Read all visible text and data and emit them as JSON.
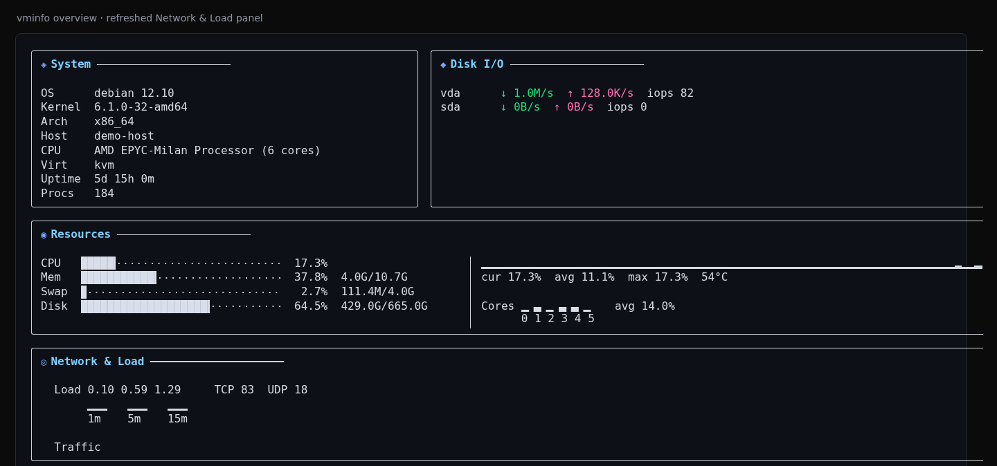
{
  "header": "vminfo overview · refreshed Network & Load panel",
  "system": {
    "icon": "◈",
    "title": "System",
    "rows": [
      {
        "label": "OS",
        "value": "debian 12.10"
      },
      {
        "label": "Kernel",
        "value": "6.1.0-32-amd64"
      },
      {
        "label": "Arch",
        "value": "x86_64"
      },
      {
        "label": "Host",
        "value": "demo-host"
      },
      {
        "label": "CPU",
        "value": "AMD EPYC-Milan Processor (6 cores)"
      },
      {
        "label": "Virt",
        "value": "kvm"
      },
      {
        "label": "Uptime",
        "value": "5d 15h 0m"
      },
      {
        "label": "Procs",
        "value": "184"
      }
    ]
  },
  "disk_io": {
    "icon": "◆",
    "title": "Disk I/O",
    "rows": [
      {
        "name": "vda",
        "read": "↓ 1.0M/s",
        "write": "↑ 128.0K/s",
        "iops": "iops 82"
      },
      {
        "name": "sda",
        "read": "↓ 0B/s",
        "write": "↑ 0B/s",
        "iops": "iops 0"
      }
    ]
  },
  "resources": {
    "icon": "◉",
    "title": "Resources",
    "meters": [
      {
        "label": "CPU",
        "level": 0.173,
        "percent": "17.3%"
      },
      {
        "label": "Mem",
        "level": 0.378,
        "percent": "37.8%",
        "detail": "4.0G/10.7G"
      },
      {
        "label": "Swap",
        "level": 0.027,
        "percent": "2.7%",
        "detail": "111.4M/4.0G"
      },
      {
        "label": "Disk",
        "level": 0.645,
        "percent": "64.5%",
        "detail": "429.0G/665.0G"
      }
    ],
    "stats": [
      "cur 17.3%",
      "avg 11.1%",
      "max 17.3%",
      "54°C"
    ],
    "cores": {
      "label": "Cores",
      "avg": "avg 14.0%",
      "items": [
        {
          "label": "0"
        },
        {
          "label": "1"
        },
        {
          "label": "2"
        },
        {
          "label": "3"
        },
        {
          "label": "4"
        },
        {
          "label": "5"
        }
      ]
    }
  },
  "network": {
    "icon": "◎",
    "title": "Network & Load",
    "load_label": "Load",
    "load_values": [
      "0.10",
      "0.59",
      "1.29"
    ],
    "tcp": "TCP 83",
    "udp": "UDP 18",
    "load_windows": [
      "1m",
      "5m",
      "15m"
    ],
    "traffic_label": "Traffic"
  }
}
